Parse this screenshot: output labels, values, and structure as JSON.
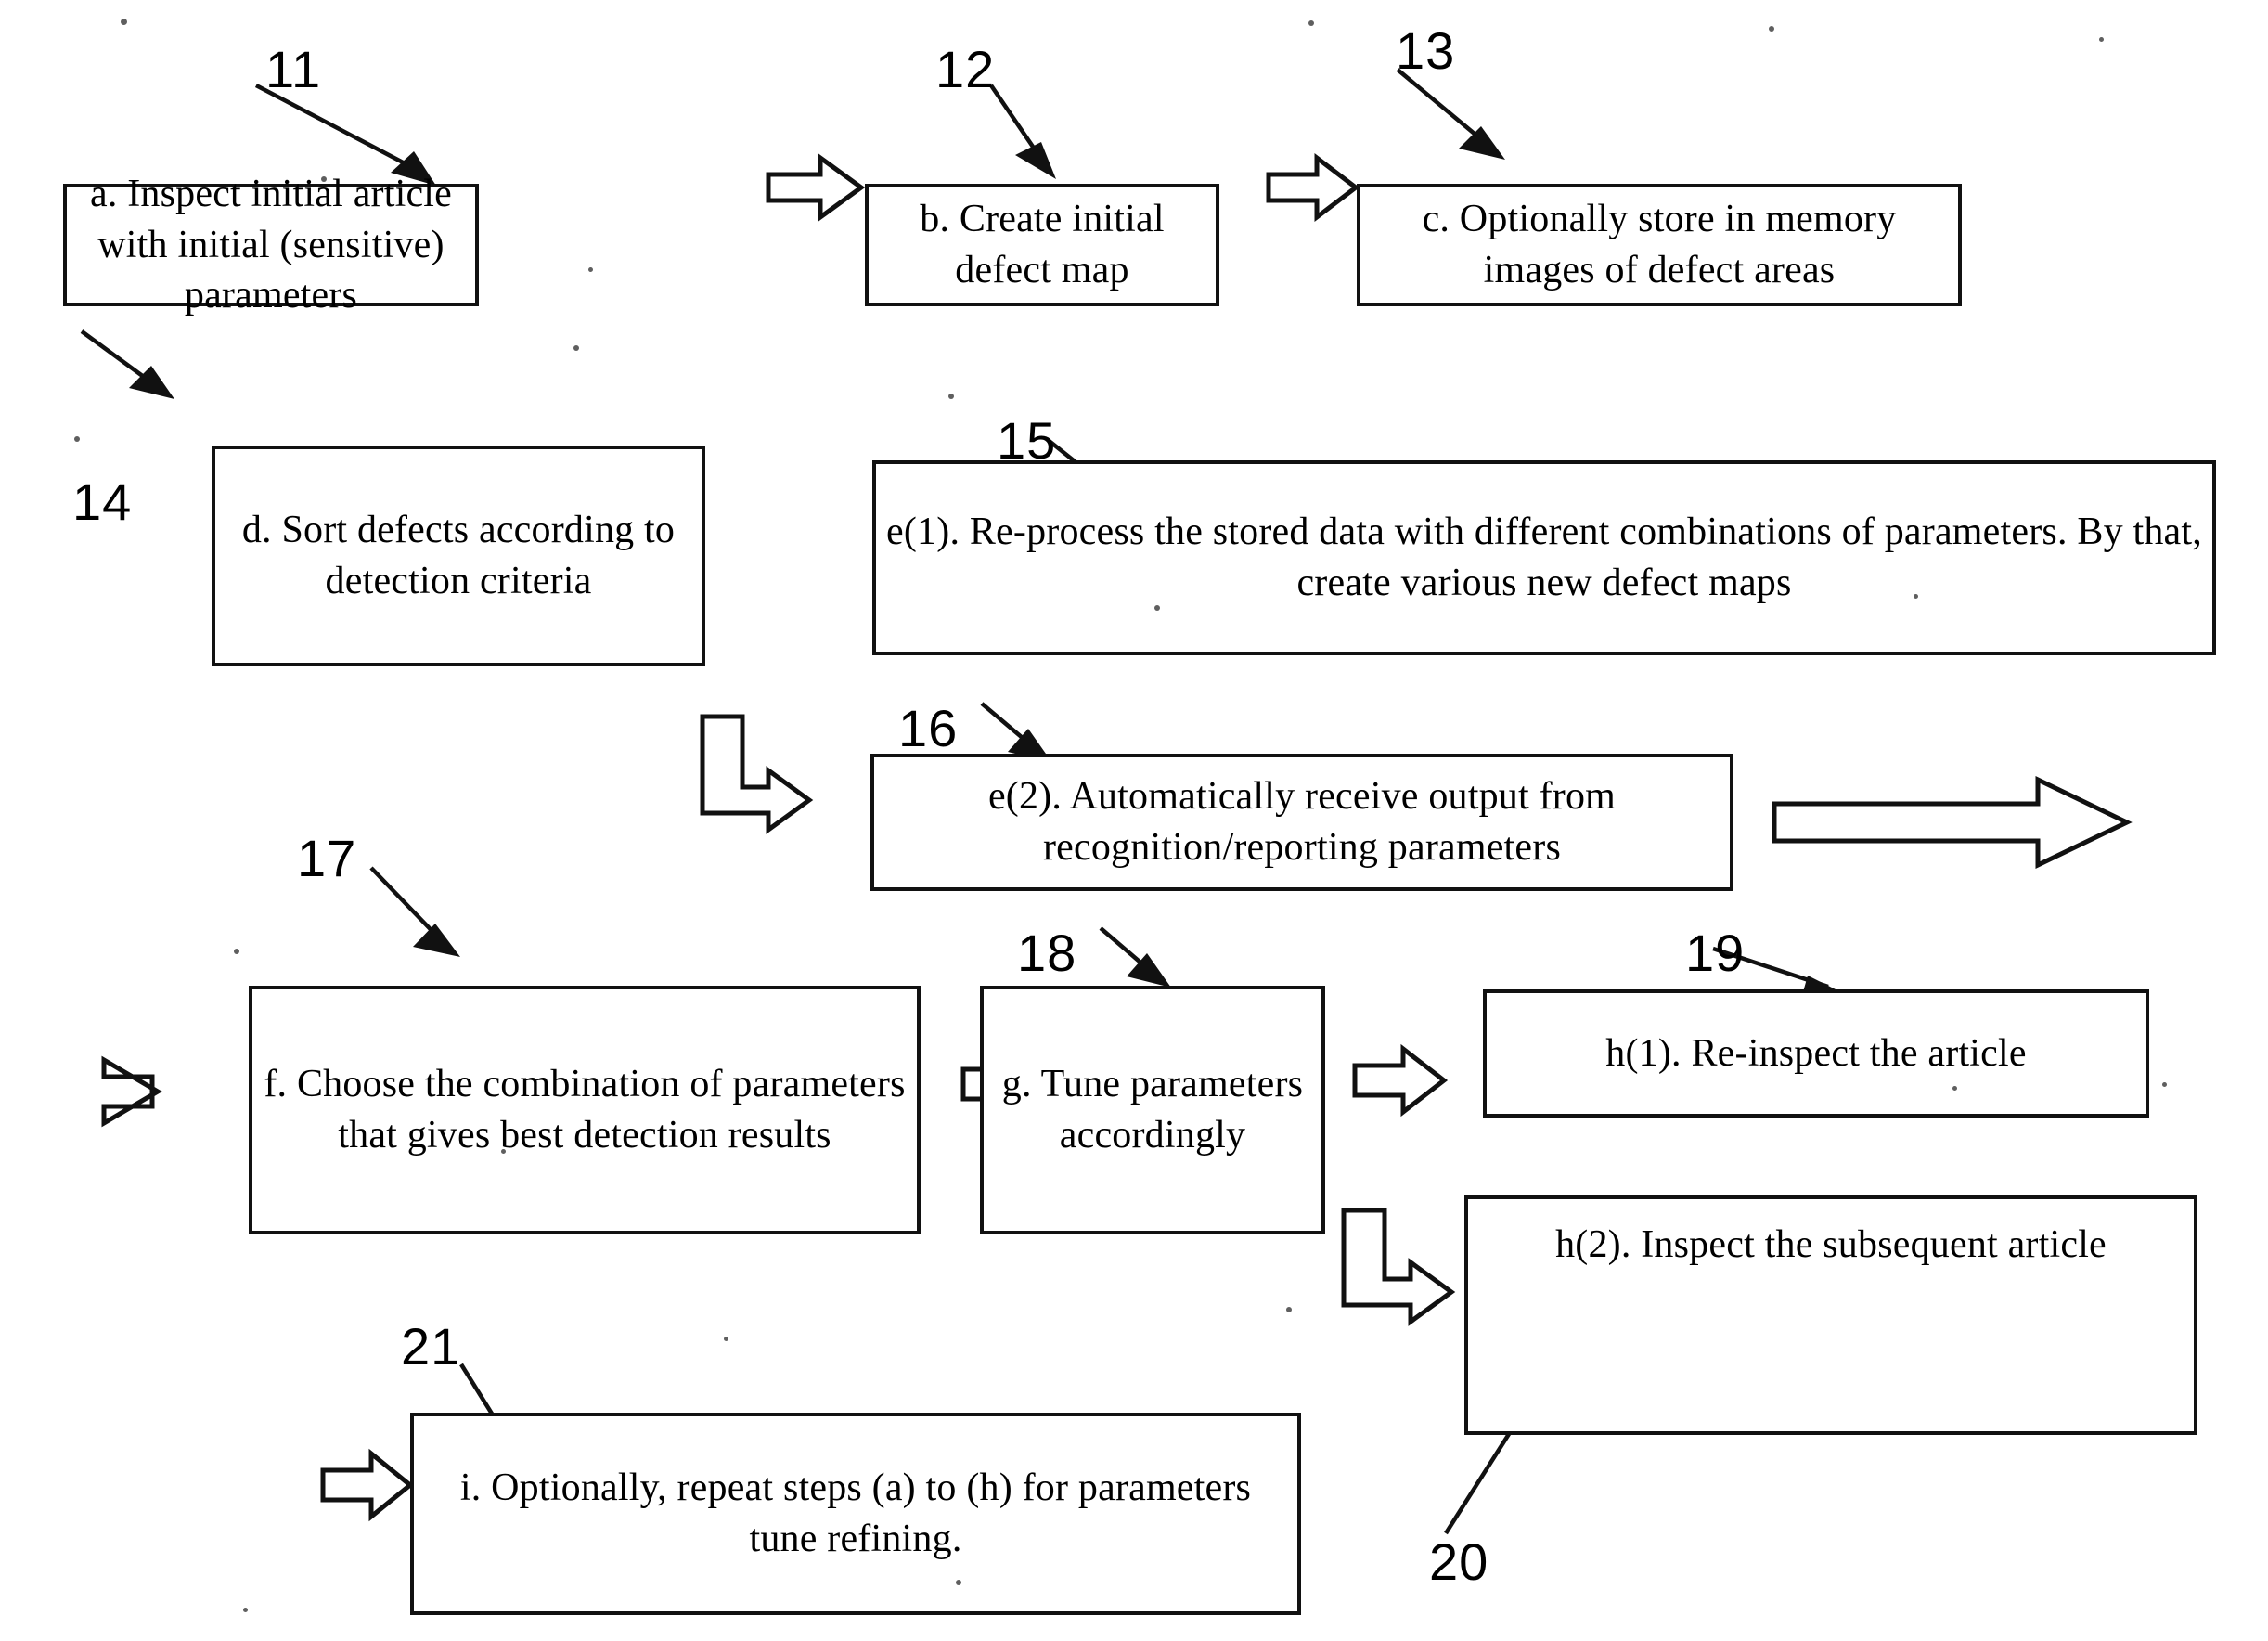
{
  "figure": {
    "type": "patent-flowchart",
    "title": "",
    "background_color": "#ffffff",
    "ink_color": "#111111"
  },
  "boxes": [
    {
      "id": "a",
      "text": "a. Inspect initial article with initial (sensitive) parameters"
    },
    {
      "id": "b",
      "text": "b. Create initial defect map"
    },
    {
      "id": "c",
      "text": "c. Optionally store in memory images of defect areas"
    },
    {
      "id": "d",
      "text": "d. Sort defects according to detection criteria"
    },
    {
      "id": "e1",
      "text": "e(1). Re-process the stored data with different combinations of parameters. By that, create various new defect maps"
    },
    {
      "id": "e2",
      "text": "e(2). Automatically receive output from recognition/reporting parameters"
    },
    {
      "id": "f",
      "text": "f. Choose the combination of parameters that gives best detection results"
    },
    {
      "id": "g",
      "text": "g. Tune parameters accordingly"
    },
    {
      "id": "h1",
      "text": "h(1). Re-inspect the article"
    },
    {
      "id": "h2",
      "text": "h(2). Inspect the subsequent article"
    },
    {
      "id": "i",
      "text": "i. Optionally, repeat steps (a) to (h) for parameters tune refining."
    }
  ],
  "reference_numerals": [
    {
      "id": "n11",
      "label": "11",
      "points_to": "a"
    },
    {
      "id": "n12",
      "label": "12",
      "points_to": "b"
    },
    {
      "id": "n13",
      "label": "13",
      "points_to": "c"
    },
    {
      "id": "n14",
      "label": "14",
      "points_to": "d"
    },
    {
      "id": "n15",
      "label": "15",
      "points_to": "e1"
    },
    {
      "id": "n16",
      "label": "16",
      "points_to": "e2"
    },
    {
      "id": "n17",
      "label": "17",
      "points_to": "f"
    },
    {
      "id": "n18",
      "label": "18",
      "points_to": "g"
    },
    {
      "id": "n19",
      "label": "19",
      "points_to": "h1"
    },
    {
      "id": "n20",
      "label": "20",
      "points_to": "h2"
    },
    {
      "id": "n21",
      "label": "21",
      "points_to": "i"
    }
  ],
  "connectors": [
    {
      "id": "arrow-a-b",
      "kind": "block-arrow-right",
      "from": "a",
      "to": "b"
    },
    {
      "id": "arrow-b-c",
      "kind": "block-arrow-right",
      "from": "b",
      "to": "c"
    },
    {
      "id": "arrow-d-e2",
      "kind": "block-arrow-elbow",
      "from": "d",
      "to": "e2"
    },
    {
      "id": "arrow-e2-out",
      "kind": "block-arrow-long-right",
      "from": "e2",
      "to": ""
    },
    {
      "id": "arrow-in-f",
      "kind": "block-arrow-right",
      "from": "",
      "to": "f"
    },
    {
      "id": "arrow-f-g",
      "kind": "block-arrow-right",
      "from": "f",
      "to": "g"
    },
    {
      "id": "arrow-g-h1",
      "kind": "block-arrow-right",
      "from": "g",
      "to": "h1"
    },
    {
      "id": "arrow-g-h2",
      "kind": "block-arrow-elbow",
      "from": "g",
      "to": "h2"
    },
    {
      "id": "arrow-in-i",
      "kind": "block-arrow-right",
      "from": "",
      "to": "i"
    }
  ]
}
